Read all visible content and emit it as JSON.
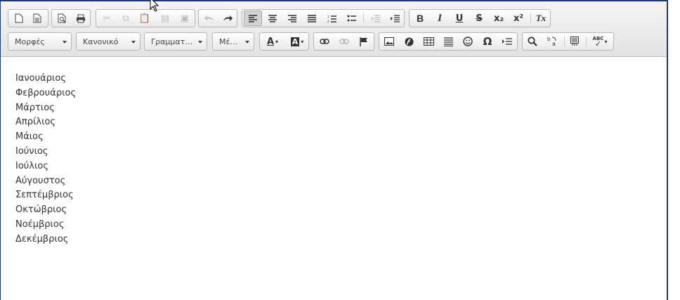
{
  "toolbar": {
    "row1": {
      "document": [
        "new-page-icon",
        "templates-icon"
      ],
      "preview": [
        "preview-icon",
        "print-icon"
      ],
      "clipboard": [
        "cut-icon",
        "copy-icon",
        "paste-icon",
        "paste-text-icon",
        "paste-word-icon"
      ],
      "history": [
        "undo-icon",
        "redo-icon"
      ],
      "align": [
        "align-left-icon",
        "align-center-icon",
        "align-right-icon",
        "justify-icon"
      ],
      "lists": [
        "numbered-list-icon",
        "bulleted-list-icon"
      ],
      "indent": [
        "outdent-icon",
        "indent-icon"
      ],
      "format": {
        "bold": "B",
        "italic": "I",
        "underline": "U",
        "strike": "S",
        "subscript": "x₂",
        "superscript": "x²",
        "clear": "Tx"
      }
    },
    "row2": {
      "styles_label": "Μορφές",
      "format_label": "Κανονικό",
      "font_label": "Γραμματ…",
      "size_label": "Μέ…",
      "color_text_letter": "A",
      "color_bg_letter": "A",
      "links": [
        "link-icon",
        "unlink-icon",
        "anchor-flag-icon"
      ],
      "insert": [
        "image-icon",
        "flash-icon",
        "table-icon",
        "horizontal-rule-icon",
        "smiley-icon",
        "special-char-icon",
        "page-break-icon"
      ],
      "special_char_glyph": "Ω",
      "tools": [
        "find-icon",
        "replace-icon",
        "show-blocks-icon",
        "spellcheck-icon"
      ],
      "spell_label": "ABC"
    }
  },
  "content": {
    "lines": [
      "Ιανουάριος",
      "Φεβρουάριος",
      "Μάρτιος",
      "Απρίλιος",
      "Μάιος",
      "Ιούνιος",
      "Ιούλιος",
      "Αύγουστος",
      "Σεπτέμβριος",
      "Οκτώβριος",
      "Νοέμβριος",
      "Δεκέμβριος"
    ]
  },
  "colors": {
    "frame_border": "#1d3a78",
    "toolbar_bg": "#e9e9e9",
    "text": "#333333"
  }
}
